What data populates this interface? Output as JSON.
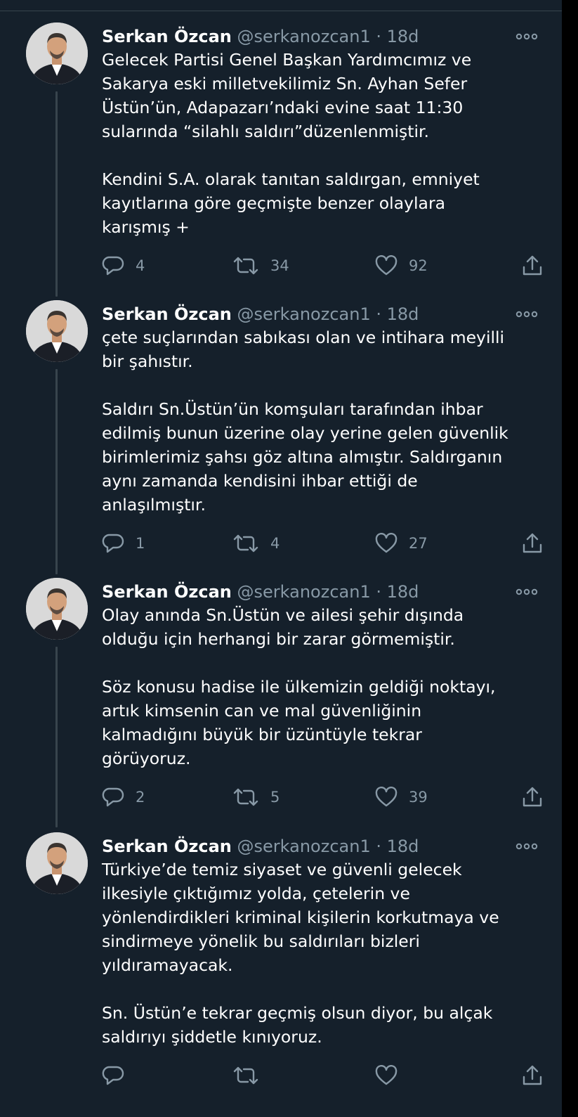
{
  "thread": {
    "author_name": "Serkan Özcan",
    "author_handle": "@serkanozcan1",
    "separator": "·",
    "timestamp": "18d",
    "colors": {
      "background": "#15202b",
      "primary_text": "#ffffff",
      "secondary_text": "#8899a6",
      "thread_line": "#38444d"
    },
    "icons": [
      "reply-icon",
      "retweet-icon",
      "like-icon",
      "share-icon",
      "more-options-icon"
    ]
  },
  "tweets": [
    {
      "text": "Gelecek Partisi Genel Başkan Yardımcımız ve\nSakarya eski milletvekilimiz Sn. Ayhan Sefer\nÜstün’ün, Adapazarı’ndaki evine saat 11:30\nsularında “silahlı saldırı”düzenlenmiştir.\n\nKendini S.A. olarak tanıtan saldırgan, emniyet\nkayıtlarına göre geçmişte benzer olaylara\nkarışmış +",
      "replies": "4",
      "retweets": "34",
      "likes": "92"
    },
    {
      "text": "çete suçlarından sabıkası olan ve intihara meyilli\nbir şahıstır.\n\nSaldırı Sn.Üstün’ün komşuları tarafından ihbar\nedilmiş bunun üzerine olay yerine gelen güvenlik\nbirimlerimiz şahsı göz altına almıştır. Saldırganın\naynı zamanda kendisini ihbar ettiği de\nanlaşılmıştır.",
      "replies": "1",
      "retweets": "4",
      "likes": "27"
    },
    {
      "text": "Olay anında Sn.Üstün ve ailesi şehir dışında\nolduğu için herhangi bir zarar görmemiştir.\n\nSöz konusu hadise ile ülkemizin geldiği noktayı,\nartık kimsenin can ve mal güvenliğinin\nkalmadığını büyük bir üzüntüyle tekrar\ngörüyoruz.",
      "replies": "2",
      "retweets": "5",
      "likes": "39"
    },
    {
      "text": "Türkiye’de temiz siyaset ve güvenli gelecek\nilkesiyle çıktığımız yolda, çetelerin ve\nyönlendirdikleri kriminal kişilerin korkutmaya ve\nsindirmeye yönelik bu saldırıları bizleri\nyıldıramayacak.\n\nSn. Üstün’e tekrar geçmiş olsun diyor, bu alçak\nsaldırıyı şiddetle kınıyoruz.",
      "replies": "",
      "retweets": "",
      "likes": ""
    }
  ]
}
